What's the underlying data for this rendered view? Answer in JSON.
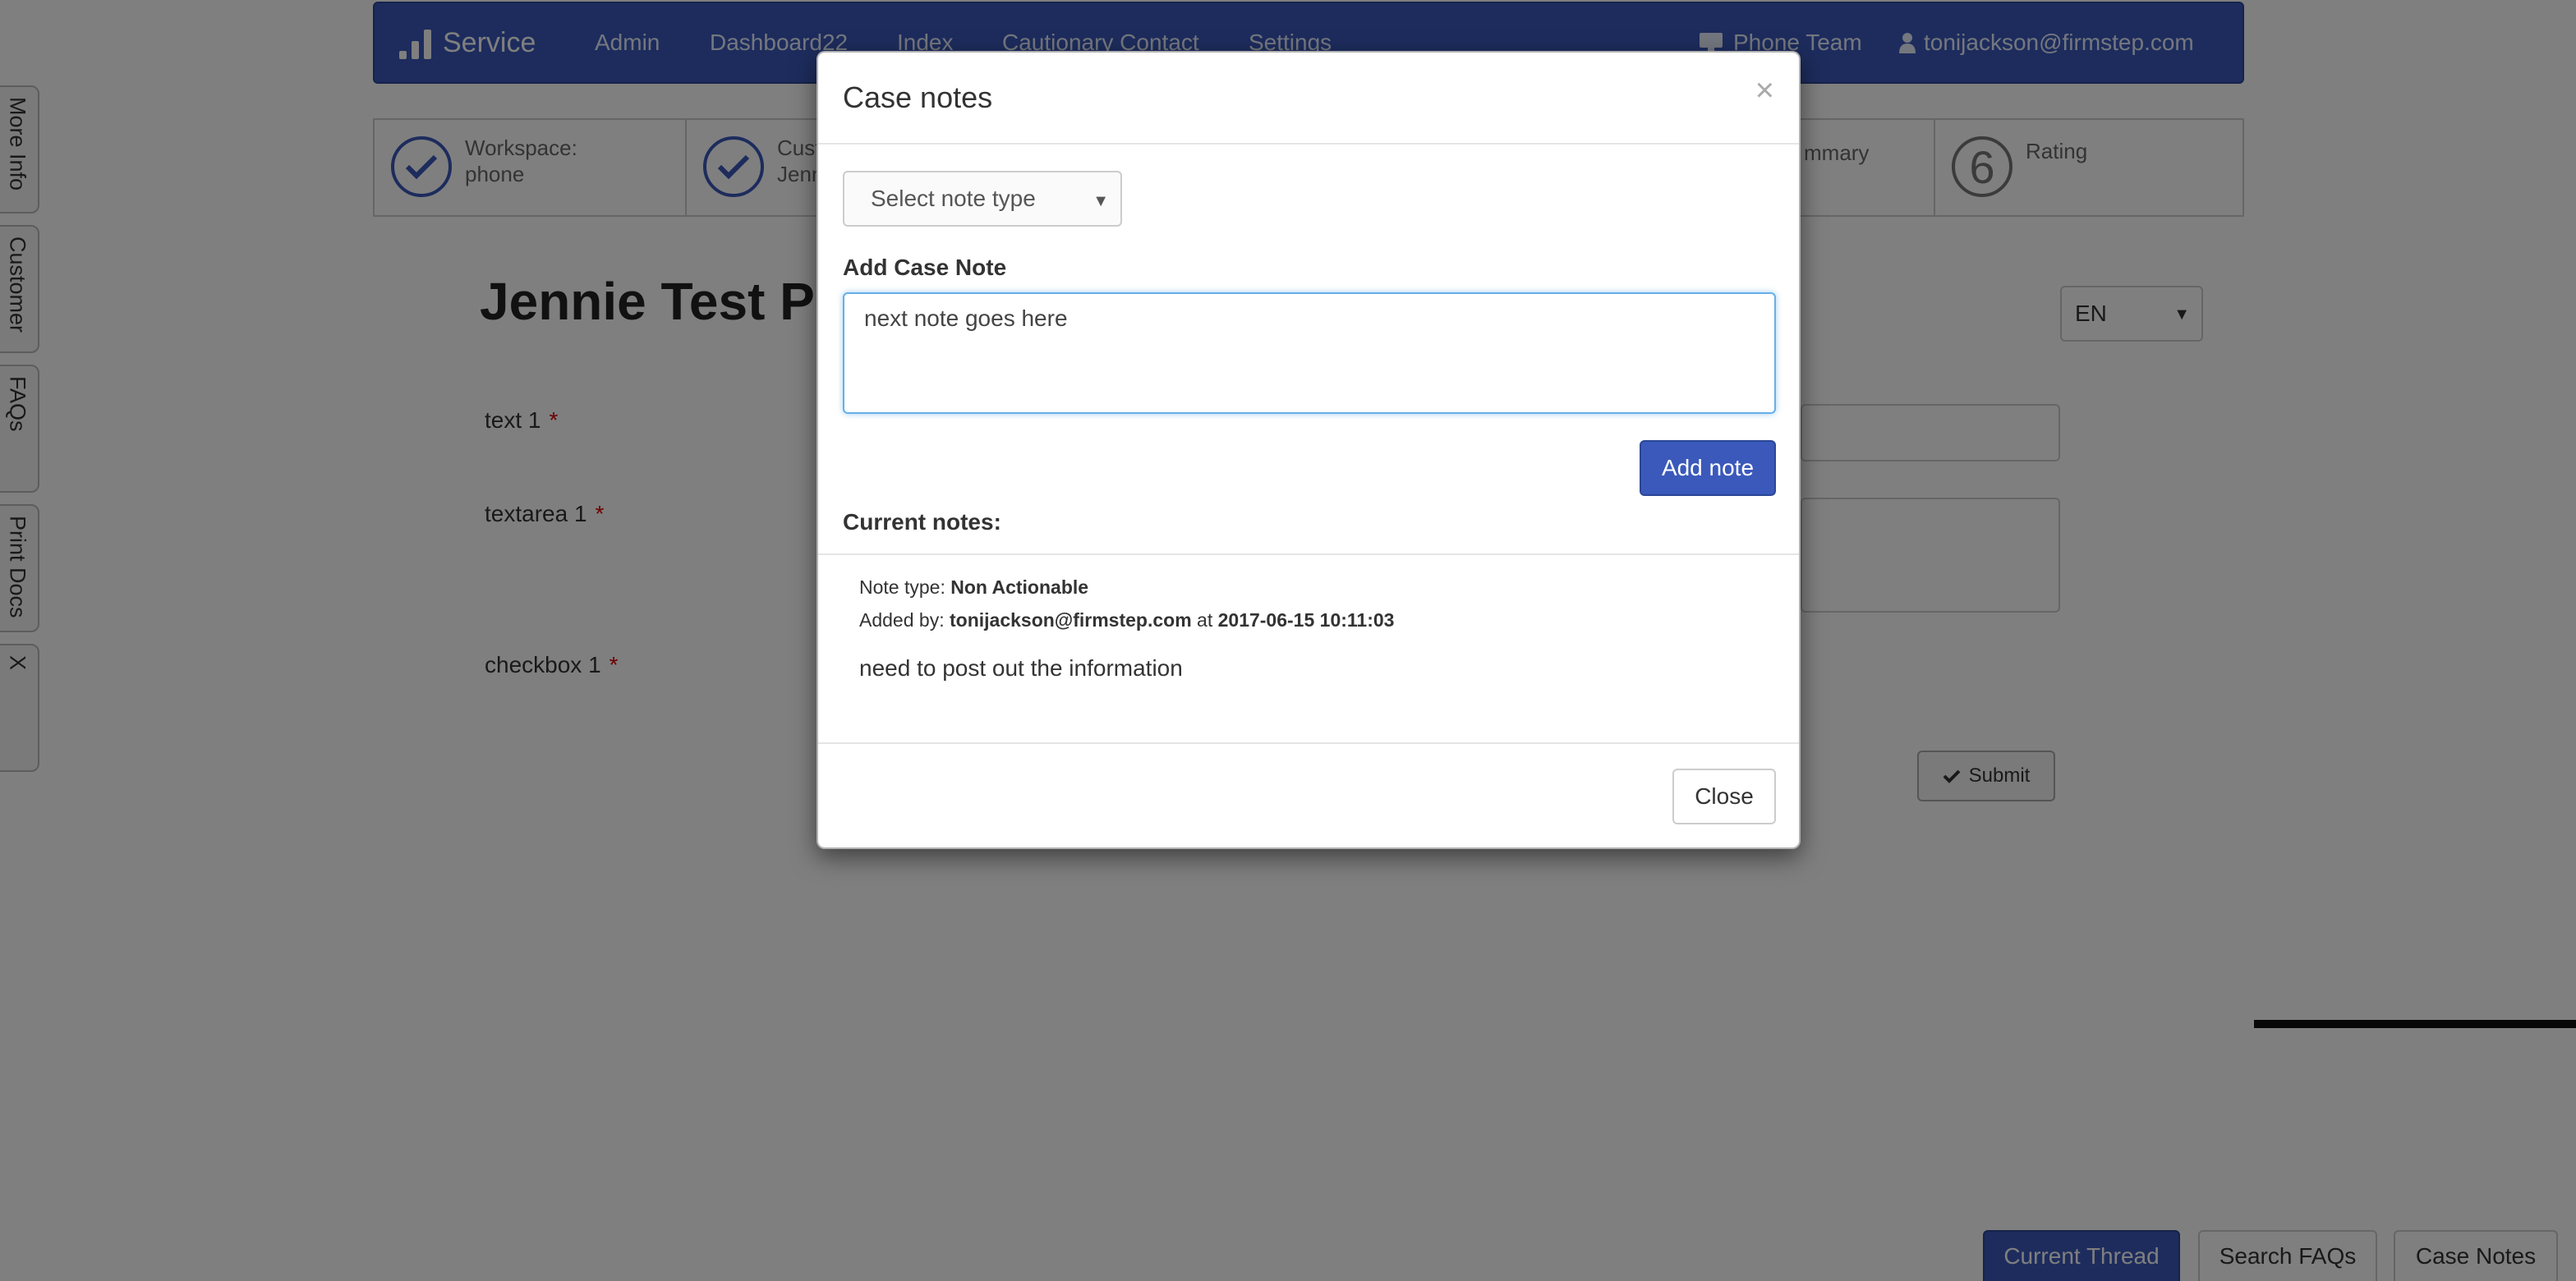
{
  "navbar": {
    "brand": "Service",
    "links": [
      "Admin",
      "Dashboard22",
      "Index",
      "Cautionary Contact",
      "Settings"
    ],
    "team": "Phone Team",
    "user": "tonijackson@firmstep.com"
  },
  "side_tabs": [
    "More Info",
    "Customer",
    "FAQs",
    "Print Docs",
    "X"
  ],
  "steps": [
    {
      "line1": "Workspace:",
      "line2": "phone"
    },
    {
      "line1": "Cust",
      "line2": "Jenn"
    },
    {
      "line1": "mmary",
      "line2": ""
    },
    {
      "number": "6",
      "line1": "Rating",
      "line2": ""
    }
  ],
  "form": {
    "title": "Jennie Test P",
    "language": "EN",
    "fields": [
      {
        "label": "text 1",
        "required": "*"
      },
      {
        "label": "textarea 1",
        "required": "*"
      },
      {
        "label": "checkbox 1",
        "required": "*"
      }
    ],
    "submit_label": "Submit"
  },
  "bottom_buttons": [
    "Current Thread",
    "Search FAQs",
    "Case Notes"
  ],
  "modal": {
    "title": "Case notes",
    "close_x": "×",
    "select_placeholder": "Select note type",
    "add_label": "Add Case Note",
    "note_value": "next note goes here",
    "add_button": "Add note",
    "current_label": "Current notes:",
    "notes": [
      {
        "type_label": "Note type:",
        "type": "Non Actionable",
        "added_by_label": "Added by:",
        "added_by": "tonijackson@firmstep.com",
        "at_label": "at",
        "timestamp": "2017-06-15 10:11:03",
        "body": "need to post out the information"
      }
    ],
    "close_button": "Close"
  },
  "colors": {
    "primary": "#3a59bb",
    "focus": "#66afe9",
    "required": "#dd0000"
  }
}
